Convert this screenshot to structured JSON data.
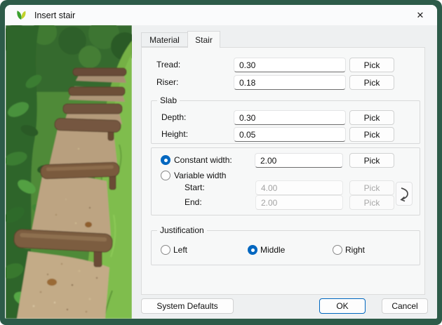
{
  "window": {
    "title": "Insert stair",
    "close_glyph": "✕"
  },
  "tabs": [
    {
      "label": "Material",
      "active": false
    },
    {
      "label": "Stair",
      "active": true
    }
  ],
  "rows": {
    "tread": {
      "label": "Tread:",
      "value": "0.30",
      "pick": "Pick"
    },
    "riser": {
      "label": "Riser:",
      "value": "0.18",
      "pick": "Pick"
    }
  },
  "slab": {
    "title": "Slab",
    "depth": {
      "label": "Depth:",
      "value": "0.30",
      "pick": "Pick"
    },
    "height": {
      "label": "Height:",
      "value": "0.05",
      "pick": "Pick"
    }
  },
  "width": {
    "constant": {
      "label": "Constant width:",
      "value": "2.00",
      "pick": "Pick",
      "selected": true
    },
    "variable": {
      "label": "Variable width",
      "selected": false
    },
    "start": {
      "label": "Start:",
      "value": "4.00",
      "pick": "Pick",
      "disabled": true
    },
    "end": {
      "label": "End:",
      "value": "2.00",
      "pick": "Pick",
      "disabled": true
    }
  },
  "justification": {
    "title": "Justification",
    "options": [
      {
        "label": "Left",
        "selected": false
      },
      {
        "label": "Middle",
        "selected": true
      },
      {
        "label": "Right",
        "selected": false
      }
    ]
  },
  "footer": {
    "system_defaults": "System Defaults",
    "ok": "OK",
    "cancel": "Cancel"
  },
  "colors": {
    "accent": "#0067c0",
    "window_border": "#2d5b49",
    "leaf_green": "#3aa02f",
    "leaf_yellow": "#c1d22b"
  },
  "preview_image": {
    "description": "Photograph of rustic log steps on a gravel dirt path climbing through green vegetation",
    "palette": {
      "foliage_dark": "#2d652a",
      "grass": "#74b045",
      "dirt": "#c3ab87",
      "log": "#7c5d41"
    }
  }
}
